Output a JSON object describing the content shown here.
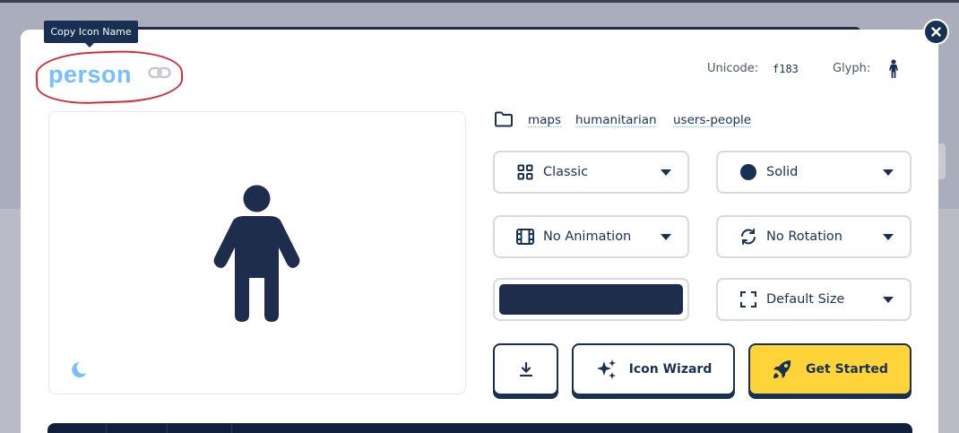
{
  "tooltip": {
    "text": "Copy Icon Name"
  },
  "icon": {
    "name": "person",
    "unicode_label": "Unicode:",
    "unicode_value": "f183",
    "glyph_label": "Glyph:"
  },
  "categories": [
    "maps",
    "humanitarian",
    "users-people"
  ],
  "selects": {
    "family": "Classic",
    "style": "Solid",
    "animation": "No Animation",
    "rotation": "No Rotation",
    "size": "Default Size"
  },
  "color_value": "#1f2d4c",
  "buttons": {
    "wizard": "Icon Wizard",
    "get_started": "Get Started"
  },
  "colors": {
    "accent_blue": "#74c0fc",
    "navy": "#183153",
    "yellow": "#ffd43b",
    "annotation_red": "#d62b38"
  },
  "icons": [
    "link-icon",
    "person-icon",
    "moon-icon",
    "folder-icon",
    "grid-icon",
    "circle-icon",
    "film-icon",
    "rotate-icon",
    "expand-icon",
    "download-icon",
    "sparkles-icon",
    "rocket-icon",
    "close-icon"
  ]
}
